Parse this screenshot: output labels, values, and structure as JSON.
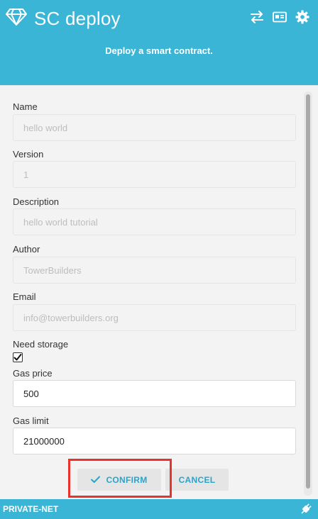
{
  "header": {
    "app_title": "SC deploy",
    "subtitle": "Deploy a smart contract.",
    "icons": [
      "gem-icon",
      "swap-icon",
      "id-card-icon",
      "gear-icon"
    ]
  },
  "form": {
    "name": {
      "label": "Name",
      "placeholder": "hello world"
    },
    "version": {
      "label": "Version",
      "placeholder": "1"
    },
    "description": {
      "label": "Description",
      "placeholder": "hello world tutorial"
    },
    "author": {
      "label": "Author",
      "placeholder": "TowerBuilders"
    },
    "email": {
      "label": "Email",
      "placeholder": "info@towerbuilders.org"
    },
    "need_storage": {
      "label": "Need storage",
      "checked": true
    },
    "gas_price": {
      "label": "Gas price",
      "value": "500"
    },
    "gas_limit": {
      "label": "Gas limit",
      "value": "21000000"
    }
  },
  "actions": {
    "confirm_label": "CONFIRM",
    "cancel_label": "CANCEL"
  },
  "footer": {
    "network": "PRIVATE-NET"
  },
  "colors": {
    "header": "#3bb5d6",
    "accent": "#2aa4c8",
    "highlight": "#e8322b"
  }
}
